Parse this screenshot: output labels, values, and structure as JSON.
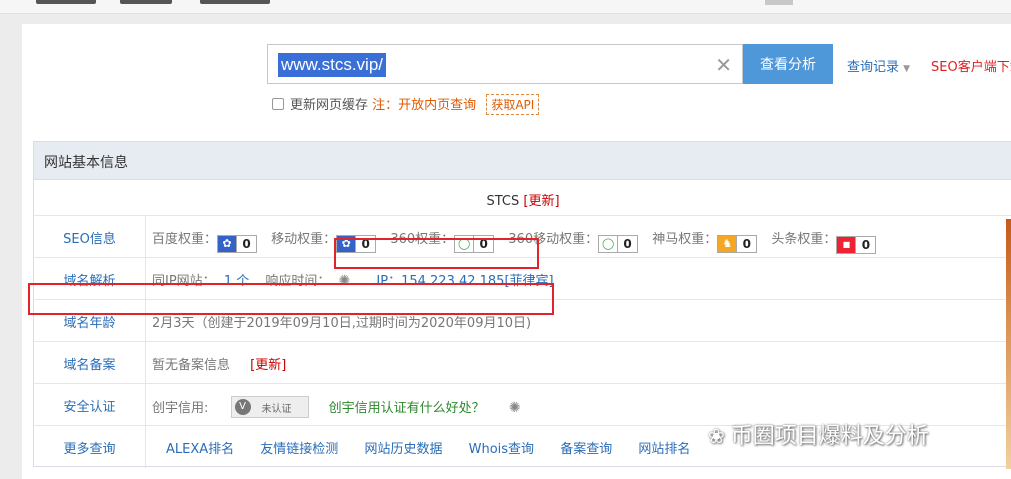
{
  "search": {
    "query": "www.stcs.vip/",
    "button": "查看分析",
    "history": "查询记录",
    "seo_client": "SEO客户端下载"
  },
  "options": {
    "refresh_cache": "更新网页缓存",
    "note": "注：开放内页查询",
    "api": "获取API"
  },
  "info": {
    "header": "网站基本信息",
    "site_name": "STCS",
    "update": "[更新]",
    "rows": {
      "seo": {
        "label": "SEO信息",
        "weights": [
          {
            "name": "百度权重：",
            "value": "0",
            "icon": "baidu-paw-icon"
          },
          {
            "name": "移动权重：",
            "value": "0",
            "icon": "baidu-paw-icon"
          },
          {
            "name": "360权重：",
            "value": "0",
            "icon": "360-ring-icon"
          },
          {
            "name": "360移动权重：",
            "value": "0",
            "icon": "360-ring-icon"
          },
          {
            "name": "神马权重：",
            "value": "0",
            "icon": "shenma-horse-icon"
          },
          {
            "name": "头条权重：",
            "value": "0",
            "icon": "toutiao-icon"
          }
        ]
      },
      "dns": {
        "label": "域名解析",
        "same_ip": "同IP网站：",
        "same_ip_count": "1 个",
        "response_time": "响应时间：",
        "ip": "IP：154.223.42.185[菲律宾]"
      },
      "age": {
        "label": "域名年龄",
        "value": "2月3天（创建于2019年09月10日,过期时间为2020年09月10日)"
      },
      "icp": {
        "label": "域名备案",
        "value": "暂无备案信息",
        "update": "[更新]"
      },
      "security": {
        "label": "安全认证",
        "credit": "创宇信用:",
        "cert_text": "未认证",
        "benefit_link": "创宇信用认证有什么好处？"
      },
      "more": {
        "label": "更多查询",
        "links": [
          "ALEXA排名",
          "友情链接检测",
          "网站历史数据",
          "Whois查询",
          "备案查询",
          "网站排名"
        ]
      }
    }
  },
  "watermark": "币圈项目爆料及分析"
}
